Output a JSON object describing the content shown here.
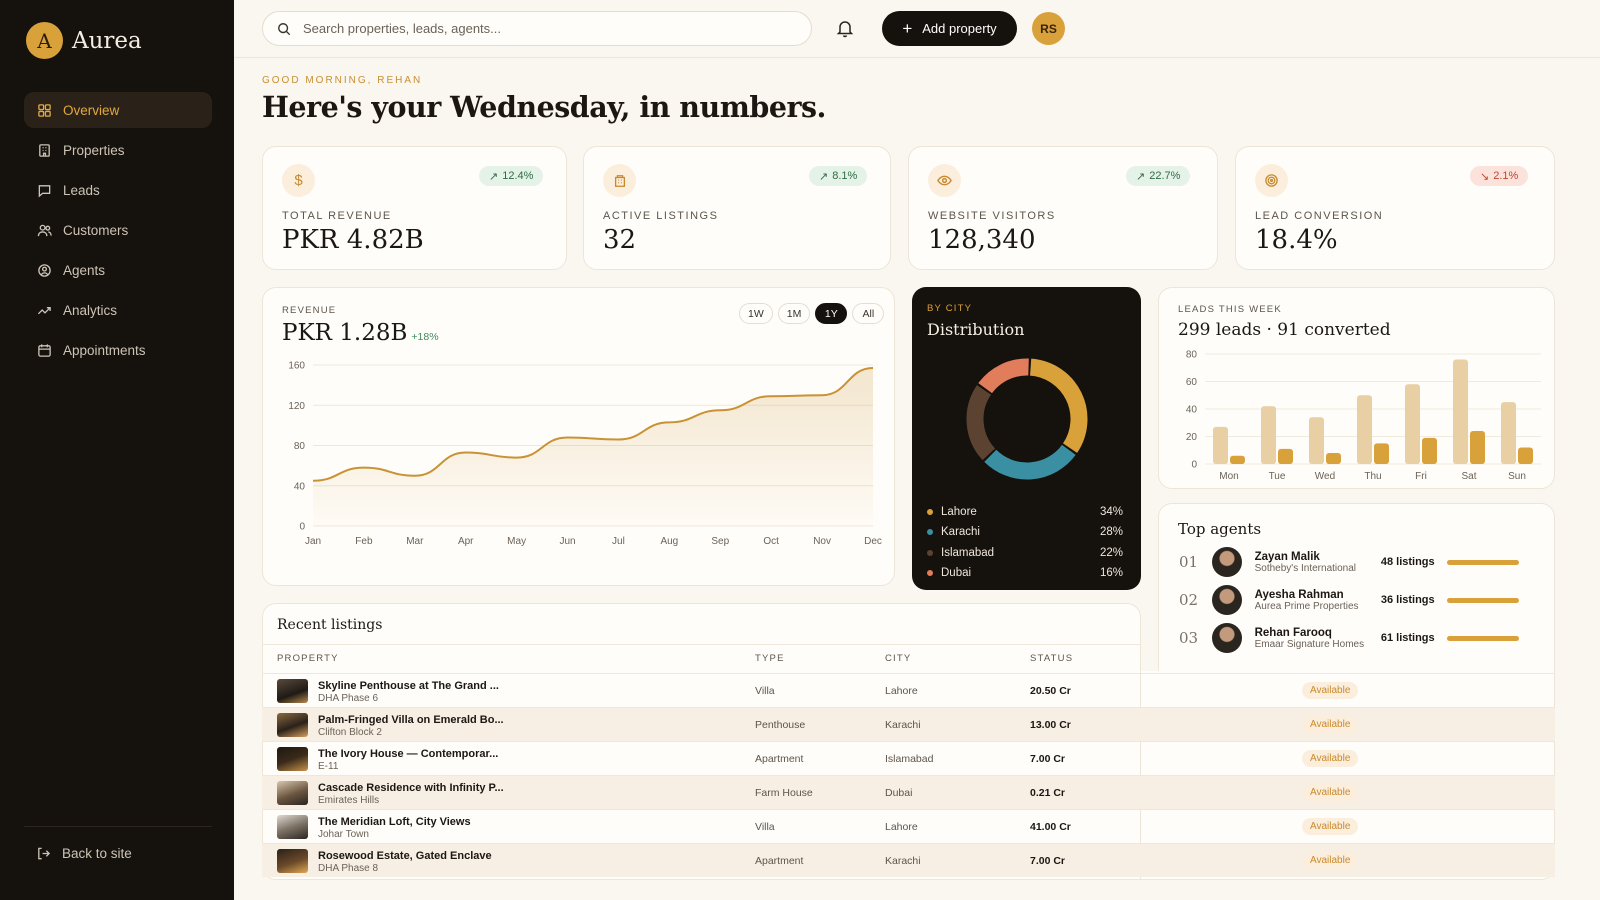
{
  "brand": {
    "initial": "A",
    "name": "Aurea"
  },
  "nav": [
    {
      "label": "Overview",
      "icon": "grid-icon",
      "active": true
    },
    {
      "label": "Properties",
      "icon": "building-icon"
    },
    {
      "label": "Leads",
      "icon": "message-square-icon"
    },
    {
      "label": "Customers",
      "icon": "users-icon"
    },
    {
      "label": "Agents",
      "icon": "user-circle-icon"
    },
    {
      "label": "Analytics",
      "icon": "trend-icon"
    },
    {
      "label": "Appointments",
      "icon": "calendar-icon"
    }
  ],
  "back_label": "Back to site",
  "search": {
    "placeholder": "Search properties, leads, agents..."
  },
  "add_button": "Add property",
  "user_initials": "RS",
  "greeting": "GOOD MORNING, REHAN",
  "headline": "Here's your Wednesday, in numbers.",
  "kpis": [
    {
      "label": "TOTAL REVENUE",
      "value": "PKR 4.82B",
      "change": "12.4%",
      "trend": "up",
      "icon": "dollar-icon"
    },
    {
      "label": "ACTIVE LISTINGS",
      "value": "32",
      "change": "8.1%",
      "trend": "up",
      "icon": "building-icon"
    },
    {
      "label": "WEBSITE VISITORS",
      "value": "128,340",
      "change": "22.7%",
      "trend": "up",
      "icon": "eye-icon"
    },
    {
      "label": "LEAD CONVERSION",
      "value": "18.4%",
      "change": "2.1%",
      "trend": "down",
      "icon": "target-icon"
    }
  ],
  "revenue": {
    "label": "REVENUE",
    "value": "PKR 1.28B",
    "change": "+18%",
    "ranges": [
      "1W",
      "1M",
      "1Y",
      "All"
    ],
    "active_range": "1Y"
  },
  "distribution": {
    "label": "BY CITY",
    "title": "Distribution",
    "cities": [
      {
        "name": "Lahore",
        "pct": "34%",
        "value": 34,
        "color": "#d9a13a"
      },
      {
        "name": "Karachi",
        "pct": "28%",
        "value": 28,
        "color": "#3b8fa3"
      },
      {
        "name": "Islamabad",
        "pct": "22%",
        "value": 22,
        "color": "#5c4331"
      },
      {
        "name": "Dubai",
        "pct": "16%",
        "value": 16,
        "color": "#e27d5b"
      }
    ]
  },
  "leads": {
    "label": "LEADS THIS WEEK",
    "title": "299 leads · 91 converted"
  },
  "agents": {
    "title": "Top agents",
    "list": [
      {
        "rank": "01",
        "name": "Zayan Malik",
        "company": "Sotheby's International",
        "listings": "48 listings",
        "bar": 1.0
      },
      {
        "rank": "02",
        "name": "Ayesha Rahman",
        "company": "Aurea Prime Properties",
        "listings": "36 listings",
        "bar": 1.0
      },
      {
        "rank": "03",
        "name": "Rehan Farooq",
        "company": "Emaar Signature Homes",
        "listings": "61 listings",
        "bar": 1.0
      }
    ]
  },
  "listings": {
    "title": "Recent listings",
    "headers": {
      "property": "PROPERTY",
      "type": "TYPE",
      "city": "CITY",
      "status": "STATUS"
    },
    "rows": [
      {
        "name": "Skyline Penthouse at The Grand ...",
        "area": "DHA Phase 6",
        "type": "Villa",
        "city": "Lahore",
        "price": "20.50 Cr",
        "status": "Available"
      },
      {
        "name": "Palm-Fringed Villa on Emerald Bo...",
        "area": "Clifton Block 2",
        "type": "Penthouse",
        "city": "Karachi",
        "price": "13.00 Cr",
        "status": "Available"
      },
      {
        "name": "The Ivory House — Contemporar...",
        "area": "E-11",
        "type": "Apartment",
        "city": "Islamabad",
        "price": "7.00 Cr",
        "status": "Available"
      },
      {
        "name": "Cascade Residence with Infinity P...",
        "area": "Emirates Hills",
        "type": "Farm House",
        "city": "Dubai",
        "price": "0.21 Cr",
        "status": "Available"
      },
      {
        "name": "The Meridian Loft, City Views",
        "area": "Johar Town",
        "type": "Villa",
        "city": "Lahore",
        "price": "41.00 Cr",
        "status": "Available"
      },
      {
        "name": "Rosewood Estate, Gated Enclave",
        "area": "DHA Phase 8",
        "type": "Apartment",
        "city": "Karachi",
        "price": "7.00 Cr",
        "status": "Available"
      }
    ]
  },
  "chart_data": [
    {
      "type": "area",
      "title": "PKR 1.28B",
      "categories": [
        "Jan",
        "Feb",
        "Mar",
        "Apr",
        "May",
        "Jun",
        "Jul",
        "Aug",
        "Sep",
        "Oct",
        "Nov",
        "Dec"
      ],
      "yticks": [
        0,
        40,
        80,
        120,
        160
      ],
      "ylim": [
        0,
        160
      ],
      "series": [
        {
          "values": [
            45,
            58,
            50,
            73,
            68,
            88,
            86,
            103,
            115,
            129,
            130,
            157
          ]
        }
      ],
      "color": "#c99234"
    },
    {
      "type": "pie",
      "title": "Distribution",
      "labels": [
        "Lahore",
        "Karachi",
        "Islamabad",
        "Dubai"
      ],
      "values": [
        34,
        28,
        22,
        16
      ]
    },
    {
      "type": "bar",
      "title": "299 leads · 91 converted",
      "categories": [
        "Mon",
        "Tue",
        "Wed",
        "Thu",
        "Fri",
        "Sat",
        "Sun"
      ],
      "yticks": [
        0,
        20,
        40,
        60,
        80
      ],
      "ylim": [
        0,
        80
      ],
      "series": [
        {
          "values": [
            27,
            42,
            34,
            50,
            58,
            76,
            45
          ],
          "color": "#e8cfa4"
        },
        {
          "values": [
            6,
            11,
            8,
            15,
            19,
            24,
            12
          ],
          "color": "#d9a13a"
        }
      ]
    }
  ]
}
